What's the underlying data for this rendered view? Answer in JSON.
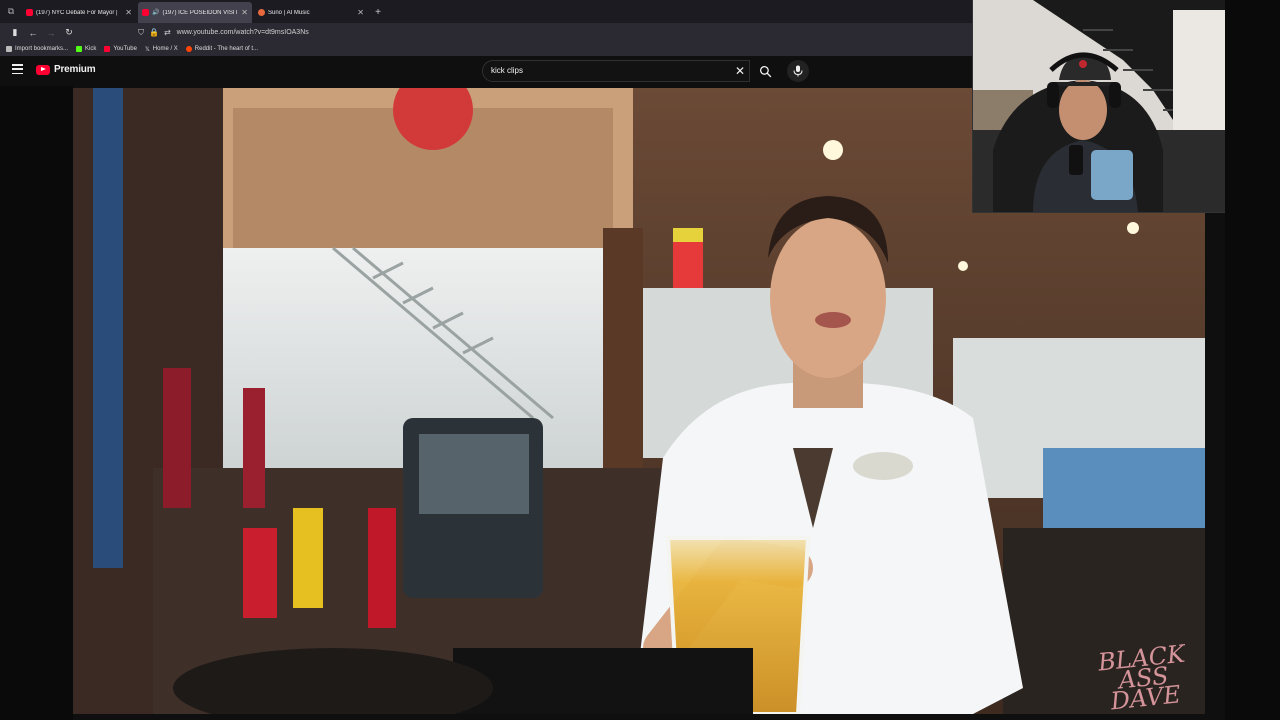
{
  "browser": {
    "tabs": [
      {
        "title": "(197) NYC Debate For Mayor | ",
        "favicon": "youtube-icon",
        "active": false
      },
      {
        "title": "(197) ICE POSEIDON VISIT",
        "favicon": "youtube-icon",
        "active": true,
        "audio": true
      },
      {
        "title": "Suno | AI Music",
        "favicon": "suno-icon",
        "active": false
      }
    ],
    "url": "www.youtube.com/watch?v=dt9msIOA3Ns",
    "bookmarks": [
      {
        "label": "Import bookmarks...",
        "color": "#bbbbbb"
      },
      {
        "label": "Kick",
        "color": "#53fc18"
      },
      {
        "label": "YouTube",
        "color": "#ff0033"
      },
      {
        "label": "Home / X",
        "color": "#ffffff"
      },
      {
        "label": "Reddit - The heart of t...",
        "color": "#ff4500"
      }
    ]
  },
  "youtube": {
    "brand": "Premium",
    "search_query": "kick clips"
  },
  "video": {
    "watermark_line1": "BLACK",
    "watermark_line2": "ASS",
    "watermark_line3": "DAVE"
  },
  "colors": {
    "youtube_red": "#ff0033",
    "watermark_pink": "#e8a0a8"
  }
}
